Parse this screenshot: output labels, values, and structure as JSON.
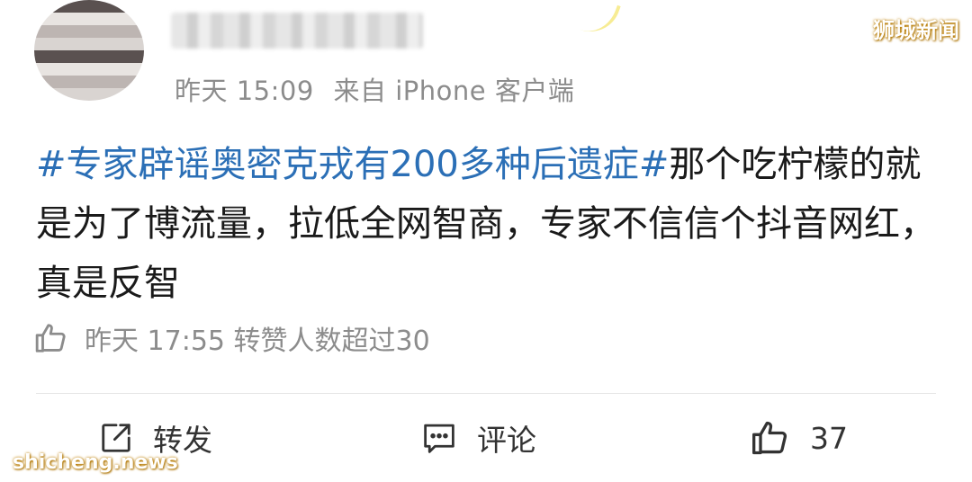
{
  "header": {
    "time": "昨天 15:09",
    "source": "来自 iPhone 客户端"
  },
  "post": {
    "hashtag": "#专家辟谣奥密克戎有200多种后遗症#",
    "body": "那个吃柠檬的就是为了博流量，拉低全网智商，专家不信信个抖音网红，真是反智"
  },
  "stats": {
    "text": "昨天 17:55 转赞人数超过30"
  },
  "actions": {
    "repost_label": "转发",
    "comment_label": "评论",
    "like_count": "37"
  },
  "watermarks": {
    "top_right": "狮城新闻",
    "bottom_left": "shicheng.news"
  },
  "colors": {
    "hashtag": "#2b6fb6",
    "meta_text": "#8c8c8c"
  },
  "icons": {
    "stats": "thumbs-up-icon",
    "repost": "share-icon",
    "comment": "comment-icon",
    "like": "thumbs-up-icon"
  }
}
